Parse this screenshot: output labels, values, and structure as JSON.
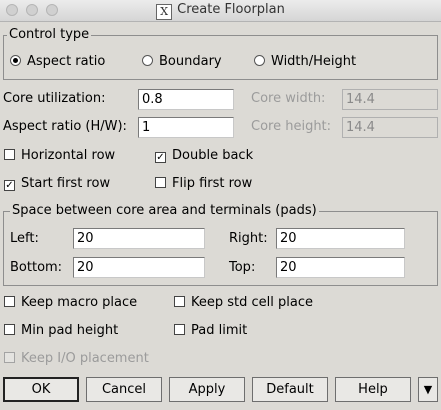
{
  "window": {
    "title": "Create Floorplan"
  },
  "control_type": {
    "legend": "Control type",
    "options": [
      {
        "label": "Aspect ratio",
        "selected": true
      },
      {
        "label": "Boundary",
        "selected": false
      },
      {
        "label": "Width/Height",
        "selected": false
      }
    ]
  },
  "fields": {
    "core_utilization": {
      "label": "Core utilization:",
      "value": "0.8"
    },
    "aspect_ratio": {
      "label": "Aspect ratio (H/W):",
      "value": "1"
    },
    "core_width": {
      "label": "Core width:",
      "value": "14.4"
    },
    "core_height": {
      "label": "Core height:",
      "value": "14.4"
    }
  },
  "checks_row": {
    "horizontal_row": {
      "label": "Horizontal row",
      "checked": false
    },
    "double_back": {
      "label": "Double back",
      "checked": true
    },
    "start_first_row": {
      "label": "Start first row",
      "checked": true
    },
    "flip_first_row": {
      "label": "Flip first row",
      "checked": false
    }
  },
  "spacing": {
    "legend": "Space between core area and terminals (pads)",
    "left": {
      "label": "Left:",
      "value": "20"
    },
    "right": {
      "label": "Right:",
      "value": "20"
    },
    "bottom": {
      "label": "Bottom:",
      "value": "20"
    },
    "top": {
      "label": "Top:",
      "value": "20"
    }
  },
  "options": {
    "keep_macro_place": {
      "label": "Keep macro place",
      "checked": false
    },
    "keep_std_cell_place": {
      "label": "Keep std cell place",
      "checked": false
    },
    "min_pad_height": {
      "label": "Min pad height",
      "checked": false
    },
    "pad_limit": {
      "label": "Pad limit",
      "checked": false
    },
    "keep_io_placement": {
      "label": "Keep I/O placement",
      "checked": false,
      "disabled": true
    }
  },
  "buttons": {
    "ok": "OK",
    "cancel": "Cancel",
    "apply": "Apply",
    "default": "Default",
    "help": "Help",
    "more": "▼"
  }
}
